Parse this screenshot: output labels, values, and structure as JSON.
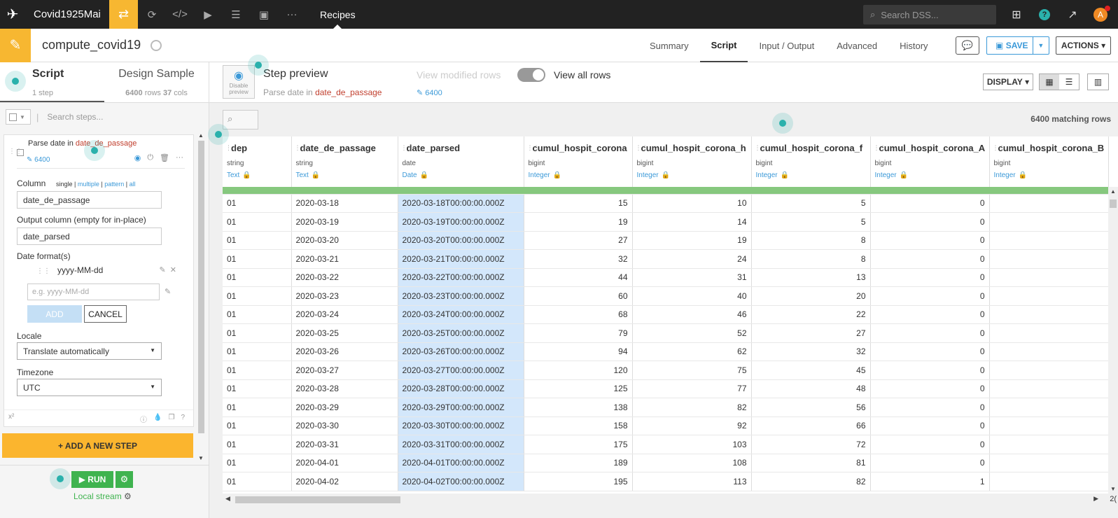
{
  "topnav": {
    "project_name": "Covid1925Mai",
    "current_section": "Recipes",
    "search_placeholder": "Search DSS...",
    "avatar_initial": "A",
    "help_label": "?"
  },
  "recipe": {
    "name": "compute_covid19",
    "tabs": [
      {
        "label": "Summary"
      },
      {
        "label": "Script",
        "active": true
      },
      {
        "label": "Input / Output"
      },
      {
        "label": "Advanced"
      },
      {
        "label": "History"
      }
    ],
    "save_label": "SAVE",
    "actions_label": "ACTIONS"
  },
  "left_panel": {
    "script_tab": {
      "title": "Script",
      "subtitle": "1 step"
    },
    "design_tab": {
      "title": "Design Sample",
      "rows": "6400",
      "rows_unit": "rows",
      "cols": "37",
      "cols_unit": "cols"
    },
    "search_placeholder": "Search steps...",
    "step": {
      "prefix": "Parse date in",
      "column": "date_de_passage",
      "row_count": "6400",
      "column_label": "Column",
      "modes": {
        "single": "single",
        "multiple": "multiple",
        "pattern": "pattern",
        "all": "all"
      },
      "column_value": "date_de_passage",
      "output_label": "Output column (empty for in-place)",
      "output_value": "date_parsed",
      "formats_label": "Date format(s)",
      "format_value": "yyyy-MM-dd",
      "format_placeholder": "e.g. yyyy-MM-dd",
      "add_label": "ADD",
      "cancel_label": "CANCEL",
      "locale_label": "Locale",
      "locale_value": "Translate automatically",
      "timezone_label": "Timezone",
      "timezone_value": "UTC",
      "footer_sup": "x²"
    },
    "add_step_label": "+ ADD A NEW STEP",
    "run_label": "RUN",
    "engine_label": "Local stream"
  },
  "preview": {
    "disable_label": "Disable preview",
    "title": "Step preview",
    "sub_prefix": "Parse date in",
    "sub_column": "date_de_passage",
    "view_modified": "View modified rows",
    "view_all": "View all rows",
    "modified_count": "6400",
    "display_label": "DISPLAY",
    "matching_rows": "6400 matching rows"
  },
  "table": {
    "columns": [
      {
        "name": "dep",
        "type": "string",
        "meaning": "Text"
      },
      {
        "name": "date_de_passage",
        "type": "string",
        "meaning": "Text"
      },
      {
        "name": "date_parsed",
        "type": "date",
        "meaning": "Date"
      },
      {
        "name": "cumul_hospit_corona",
        "type": "bigint",
        "meaning": "Integer"
      },
      {
        "name": "cumul_hospit_corona_h",
        "type": "bigint",
        "meaning": "Integer"
      },
      {
        "name": "cumul_hospit_corona_f",
        "type": "bigint",
        "meaning": "Integer"
      },
      {
        "name": "cumul_hospit_corona_A",
        "type": "bigint",
        "meaning": "Integer"
      },
      {
        "name": "cumul_hospit_corona_B",
        "type": "bigint",
        "meaning": "Integer"
      }
    ],
    "rows": [
      [
        "01",
        "2020-03-18",
        "2020-03-18T00:00:00.000Z",
        "15",
        "10",
        "5",
        "0",
        ""
      ],
      [
        "01",
        "2020-03-19",
        "2020-03-19T00:00:00.000Z",
        "19",
        "14",
        "5",
        "0",
        ""
      ],
      [
        "01",
        "2020-03-20",
        "2020-03-20T00:00:00.000Z",
        "27",
        "19",
        "8",
        "0",
        ""
      ],
      [
        "01",
        "2020-03-21",
        "2020-03-21T00:00:00.000Z",
        "32",
        "24",
        "8",
        "0",
        ""
      ],
      [
        "01",
        "2020-03-22",
        "2020-03-22T00:00:00.000Z",
        "44",
        "31",
        "13",
        "0",
        ""
      ],
      [
        "01",
        "2020-03-23",
        "2020-03-23T00:00:00.000Z",
        "60",
        "40",
        "20",
        "0",
        ""
      ],
      [
        "01",
        "2020-03-24",
        "2020-03-24T00:00:00.000Z",
        "68",
        "46",
        "22",
        "0",
        ""
      ],
      [
        "01",
        "2020-03-25",
        "2020-03-25T00:00:00.000Z",
        "79",
        "52",
        "27",
        "0",
        ""
      ],
      [
        "01",
        "2020-03-26",
        "2020-03-26T00:00:00.000Z",
        "94",
        "62",
        "32",
        "0",
        ""
      ],
      [
        "01",
        "2020-03-27",
        "2020-03-27T00:00:00.000Z",
        "120",
        "75",
        "45",
        "0",
        ""
      ],
      [
        "01",
        "2020-03-28",
        "2020-03-28T00:00:00.000Z",
        "125",
        "77",
        "48",
        "0",
        ""
      ],
      [
        "01",
        "2020-03-29",
        "2020-03-29T00:00:00.000Z",
        "138",
        "82",
        "56",
        "0",
        ""
      ],
      [
        "01",
        "2020-03-30",
        "2020-03-30T00:00:00.000Z",
        "158",
        "92",
        "66",
        "0",
        ""
      ],
      [
        "01",
        "2020-03-31",
        "2020-03-31T00:00:00.000Z",
        "175",
        "103",
        "72",
        "0",
        ""
      ],
      [
        "01",
        "2020-04-01",
        "2020-04-01T00:00:00.000Z",
        "189",
        "108",
        "81",
        "0",
        ""
      ],
      [
        "01",
        "2020-04-02",
        "2020-04-02T00:00:00.000Z",
        "195",
        "113",
        "82",
        "1",
        ""
      ]
    ],
    "corner_text": "2("
  },
  "colors": {
    "accent_yellow": "#f7b731",
    "link_blue": "#3b99d8",
    "run_green": "#3fb34f",
    "column_red": "#c13f2e",
    "valid_bar": "#86c87e",
    "hotspot": "#2ab1ac"
  },
  "icons": [
    "bird-logo-icon",
    "flow-icon",
    "cycle-icon",
    "code-icon",
    "play-icon",
    "stack-icon",
    "dashboard-icon",
    "more-icon",
    "search-icon",
    "apps-grid-icon",
    "help-icon",
    "activity-icon",
    "broom-icon",
    "compass-icon",
    "chat-icon",
    "floppy-icon",
    "eye-icon",
    "power-icon",
    "trash-icon",
    "pencil-icon",
    "gear-icon",
    "list-icon",
    "chart-icon",
    "lock-icon"
  ]
}
